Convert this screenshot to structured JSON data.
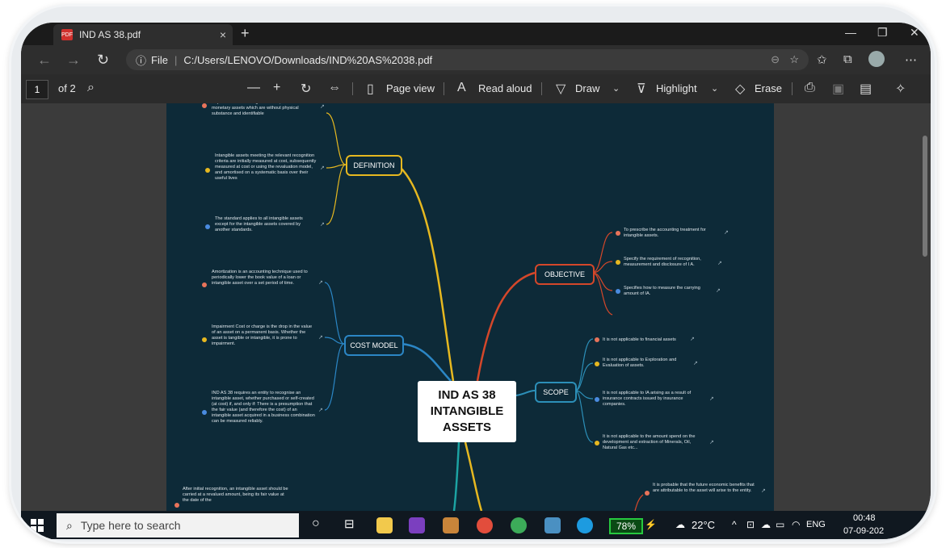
{
  "tab": {
    "title": "IND AS 38.pdf",
    "close": "×",
    "new_tab": "+"
  },
  "window_controls": {
    "minimize": "—",
    "maximize": "❐",
    "close": "✕"
  },
  "address": {
    "prefix": "File",
    "url": "C:/Users/LENOVO/Downloads/IND%20AS%2038.pdf"
  },
  "pdf_toolbar": {
    "page_current": "1",
    "page_total": "of 2",
    "page_view": "Page view",
    "read_aloud": "Read aloud",
    "draw": "Draw",
    "highlight": "Highlight",
    "erase": "Erase"
  },
  "mindmap": {
    "center_lines": [
      "IND AS 38",
      "INTANGIBLE",
      "ASSETS"
    ],
    "branches": {
      "definition": "DEFINITION",
      "cost_model": "COST MODEL",
      "objective": "OBJECTIVE",
      "scope": "SCOPE"
    },
    "definition_leaves": [
      "requirements for intangible assets, which are non-monetary assets which are without physical substance and identifiable",
      "Intangible assets meeting the relevant recognition criteria are initially measured at cost, subsequently measured at cost or using the revaluation model, and amortised on a systematic basis over their useful lives",
      "The standard applies to all intangible assets except for the intangible assets covered by another standards."
    ],
    "cost_model_leaves": [
      "Amortization is an accounting technique used to periodically lower the book value of a loan or intangible asset over a set period of time.",
      "Impairment Cost or charge is the drop in the value of an asset on a permanent basis. Whether the asset is tangible or intangible, it is prone to impairment.",
      "IND AS 38 requires an entity to recognise an intangible asset, whether purchased or self-created (at cost) if, and only if: There is a presumption that the fair value (and therefore the cost) of an intangible asset acquired in a business combination can be measured reliably."
    ],
    "objective_leaves": [
      "To prescribe the accounting treatment for intangible assets.",
      "Specify the requirement of recognition, measurement and disclosure of I A.",
      "Specifies how to measure the carrying amount of IA."
    ],
    "scope_leaves": [
      "It is not applicable to financial assets",
      "It is not applicable to Exploration and Evaluation of assets.",
      "It is not applicable to IA arising as a result of insurance contracts issued by insurance companies.",
      "It is not applicable to the amount spend on the development and extraction of Minerals, Oil, Natural Gas etc..."
    ],
    "bottom_left_leaf": "After initial recognition, an intangible asset should be carried at a revalued amount, being its fair value at the date of the",
    "bottom_right_leaf": "It is probable that the future economic benefits that are attributable to the asset will arise to the entity."
  },
  "taskbar": {
    "search_placeholder": "Type here to search",
    "battery": "78%",
    "temperature": "22°C",
    "language": "ENG",
    "time": "00:48",
    "date": "07-09-202"
  },
  "colors": {
    "definition": "#e6b820",
    "cost_model": "#2b86c5",
    "objective": "#d4472a",
    "scope": "#2c8fb8",
    "page_bg": "#0d2a38"
  }
}
